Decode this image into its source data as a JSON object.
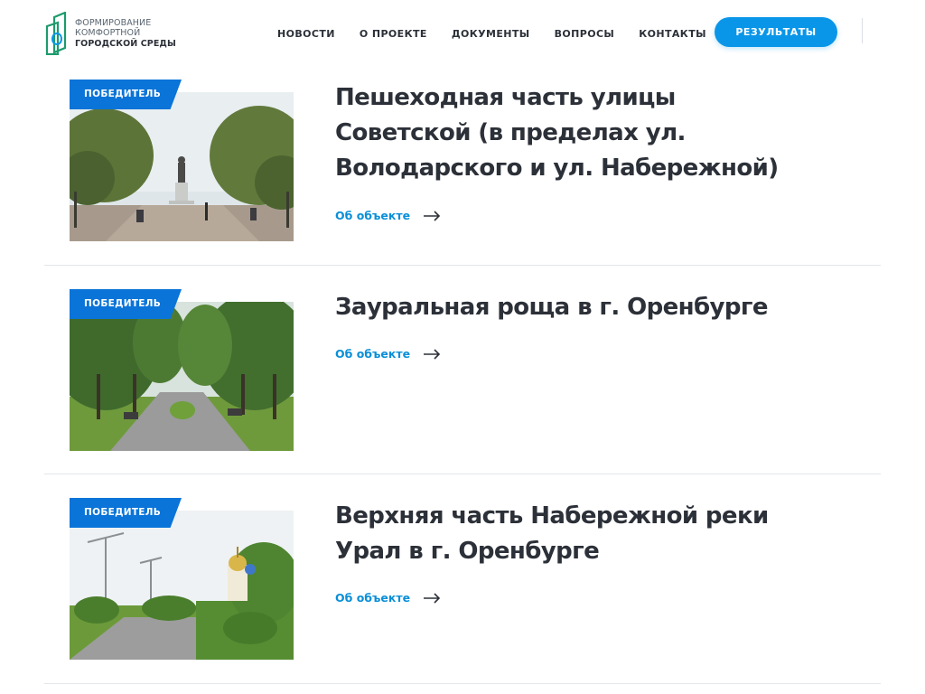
{
  "logo": {
    "line1": "Формирование",
    "line2": "комфортной",
    "line3": "городской среды"
  },
  "nav": {
    "items": [
      {
        "label": "НОВОСТИ"
      },
      {
        "label": "О ПРОЕКТЕ"
      },
      {
        "label": "ДОКУМЕНТЫ"
      },
      {
        "label": "ВОПРОСЫ"
      },
      {
        "label": "КОНТАКТЫ"
      }
    ],
    "results_button": "РЕЗУЛЬТАТЫ"
  },
  "colors": {
    "accent": "#0a96e8",
    "badge": "#0a74d8",
    "link": "#0a8fd8",
    "logo_green": "#1d9b6c"
  },
  "projects": [
    {
      "badge": "ПОБЕДИТЕЛЬ",
      "title": "Пешеходная часть улицы Советской (в пределах ул. Володарского и ул. Набережной)",
      "link": "Об объекте",
      "image": "photo-pedestrian-street-monument"
    },
    {
      "badge": "ПОБЕДИТЕЛЬ",
      "title": "Зауральная роща в г. Оренбурге",
      "link": "Об объекте",
      "image": "photo-park-alley"
    },
    {
      "badge": "ПОБЕДИТЕЛЬ",
      "title": "Верхняя часть Набережной реки Урал в г. Оренбурге",
      "link": "Об объекте",
      "image": "photo-embankment-church"
    }
  ]
}
